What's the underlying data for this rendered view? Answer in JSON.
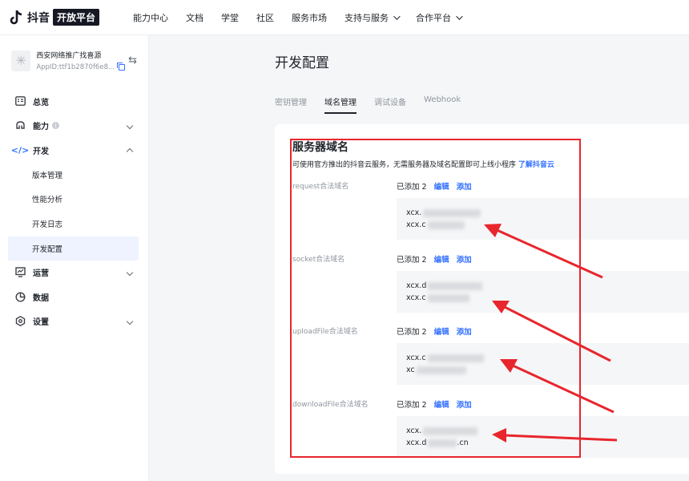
{
  "header": {
    "logo_text": "抖音",
    "logo_badge": "开放平台",
    "nav": [
      {
        "label": "能力中心",
        "dropdown": false
      },
      {
        "label": "文档",
        "dropdown": false
      },
      {
        "label": "学堂",
        "dropdown": false
      },
      {
        "label": "社区",
        "dropdown": false
      },
      {
        "label": "服务市场",
        "dropdown": false
      },
      {
        "label": "支持与服务",
        "dropdown": true
      },
      {
        "label": "合作平台",
        "dropdown": true
      }
    ]
  },
  "app": {
    "name": "西安网络推广找喜源",
    "app_id": "AppID:ttf1b2870f6e8..."
  },
  "sidebar": {
    "overview": "总览",
    "capability": "能力",
    "develop": "开发",
    "develop_sub": [
      "版本管理",
      "性能分析",
      "开发日志",
      "开发配置"
    ],
    "operate": "运营",
    "data": "数据",
    "settings": "设置"
  },
  "main": {
    "title": "开发配置",
    "tabs": [
      "密钥管理",
      "域名管理",
      "调试设备",
      "Webhook"
    ],
    "active_tab": 1,
    "section_title": "服务器域名",
    "section_desc": "可使用官方推出的抖音云服务，无需服务器及域名配置即可上线小程序",
    "section_link": "了解抖音云",
    "rows": [
      {
        "label": "request合法域名",
        "status": "已添加 2",
        "edit": "编辑",
        "add": "添加",
        "domains": [
          "xcx.",
          "xcx.c"
        ]
      },
      {
        "label": "socket合法域名",
        "status": "已添加 2",
        "edit": "编辑",
        "add": "添加",
        "domains": [
          "xcx.d",
          "xcx.c"
        ]
      },
      {
        "label": "uploadFile合法域名",
        "status": "已添加 2",
        "edit": "编辑",
        "add": "添加",
        "domains": [
          "xcx.c",
          "xc"
        ]
      },
      {
        "label": "downloadFile合法域名",
        "status": "已添加 2",
        "edit": "编辑",
        "add": "添加",
        "domains": [
          "xcx.",
          "xcx.d"
        ],
        "domain_tail": ".cn"
      }
    ]
  },
  "colors": {
    "accent": "#3370ff",
    "annotation": "#e8262d"
  }
}
